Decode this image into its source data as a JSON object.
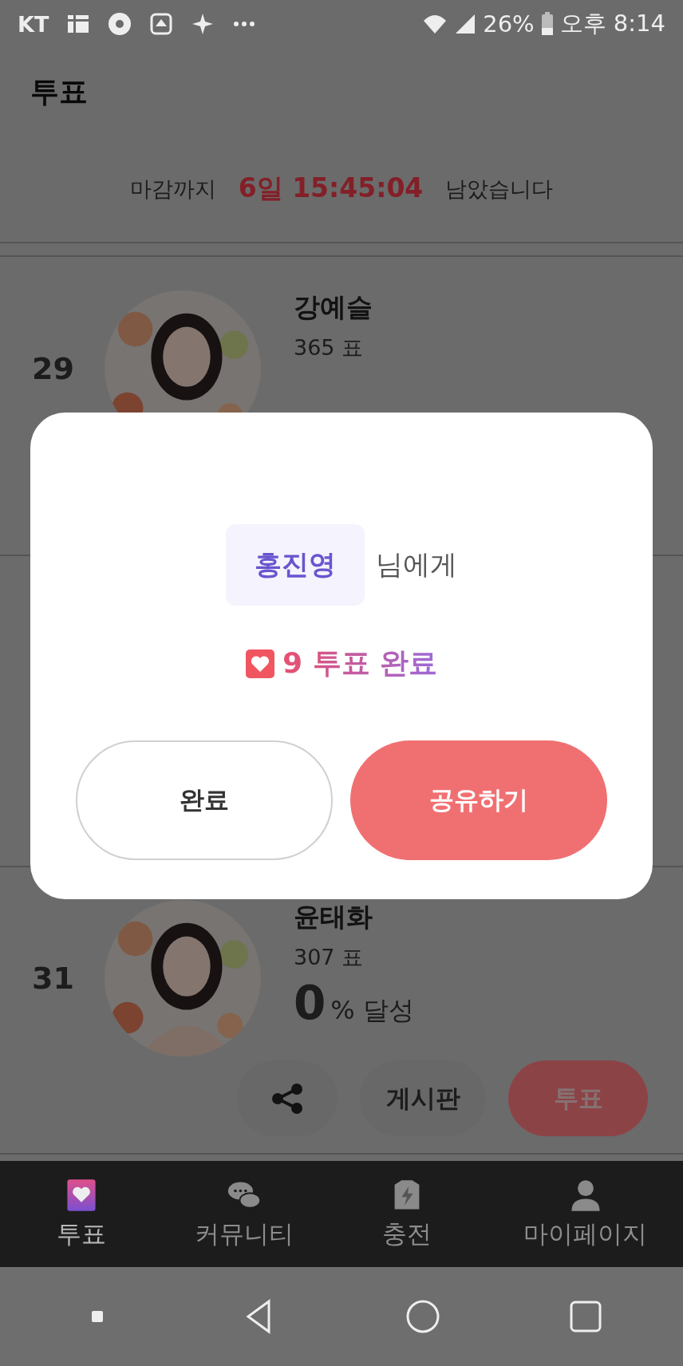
{
  "status_bar": {
    "carrier": "KT",
    "battery": "26%",
    "time": "오후 8:14"
  },
  "header": {
    "title": "투표"
  },
  "deadline": {
    "prefix": "마감까지",
    "remaining": "6일 15:45:04",
    "suffix": "남았습니다"
  },
  "candidates": [
    {
      "rank": "29",
      "name": "강예슬",
      "votes": "365 표"
    },
    {
      "rank": "31",
      "name": "윤태화",
      "votes": "307 표",
      "percent": "0",
      "percent_suffix": "% 달성",
      "board": "게시판",
      "vote": "투표"
    }
  ],
  "dialog": {
    "recipient": "홍진영",
    "recipient_suffix": "님에게",
    "result": "9 투표 완료",
    "buttons": [
      {
        "label": "완료",
        "kind": "secondary"
      },
      {
        "label": "공유하기",
        "kind": "primary"
      }
    ]
  },
  "bottom_nav": [
    {
      "label": "투표",
      "selected": true
    },
    {
      "label": "커뮤니티",
      "selected": false
    },
    {
      "label": "충전",
      "selected": false
    },
    {
      "label": "마이페이지",
      "selected": false
    }
  ]
}
